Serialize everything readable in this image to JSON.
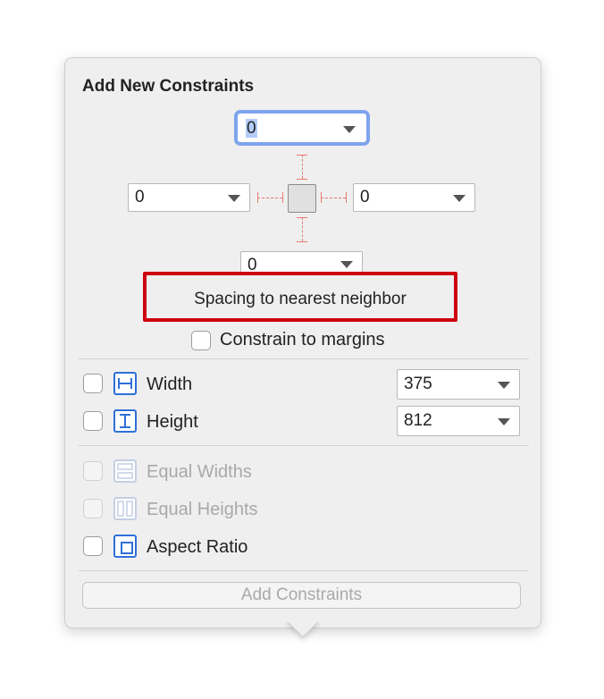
{
  "popover": {
    "title": "Add New Constraints"
  },
  "spacing": {
    "top": "0",
    "left": "0",
    "right": "0",
    "bottom": "0",
    "hint": "Spacing to nearest neighbor"
  },
  "constrain_margins": {
    "label": "Constrain to margins",
    "checked": false
  },
  "size": {
    "width": {
      "label": "Width",
      "value": "375",
      "checked": false,
      "icon": "width-icon"
    },
    "height": {
      "label": "Height",
      "value": "812",
      "checked": false,
      "icon": "height-icon"
    }
  },
  "equal": {
    "widths": {
      "label": "Equal Widths",
      "enabled": false,
      "icon": "equal-widths-icon"
    },
    "heights": {
      "label": "Equal Heights",
      "enabled": false,
      "icon": "equal-heights-icon"
    }
  },
  "aspect": {
    "label": "Aspect Ratio",
    "checked": false,
    "icon": "aspect-ratio-icon"
  },
  "footer": {
    "button": "Add Constraints"
  },
  "colors": {
    "accent": "#2f6fd9",
    "highlight": "#cc0010",
    "strut": "#e87a72",
    "focus": "#7fa4ee"
  }
}
